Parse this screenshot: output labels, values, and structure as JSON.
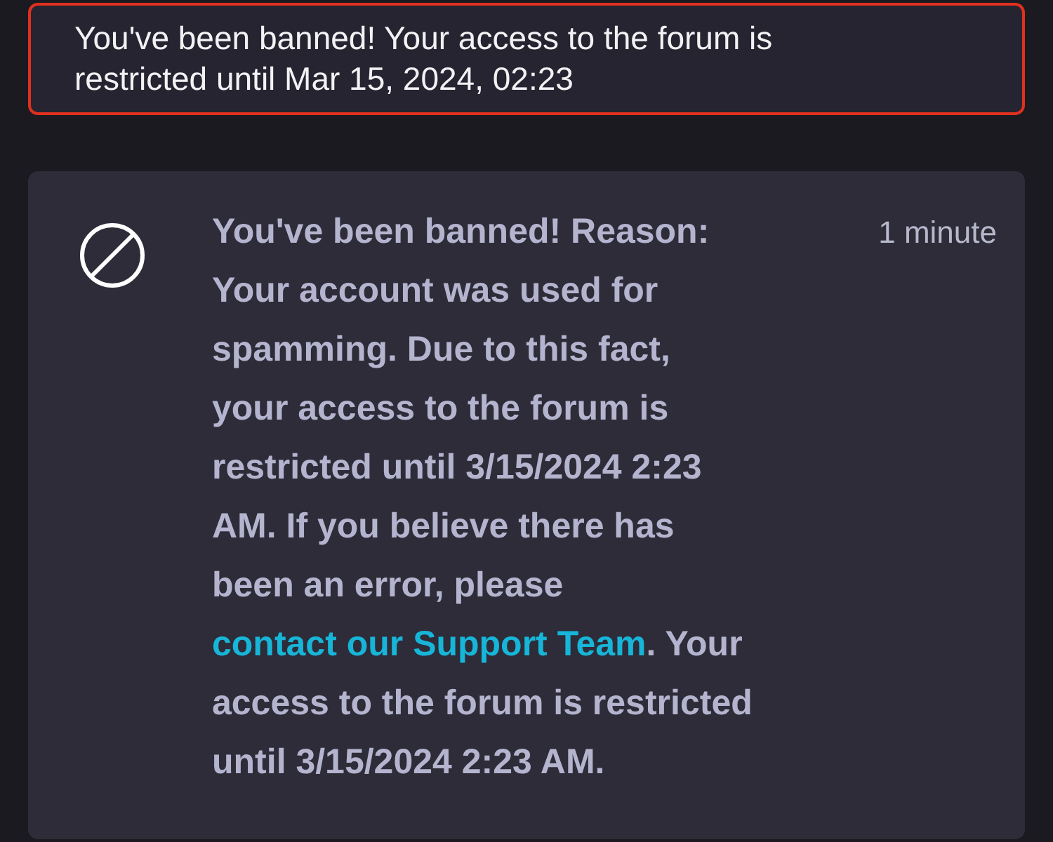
{
  "alert": {
    "text": "You've been banned! Your access to the forum is restricted until Mar 15, 2024, 02:23"
  },
  "notification": {
    "message_before": "You've been banned! Reason: Your account was used for spamming. Due to this fact, your access to the forum is restricted until 3/15/2024 2:23 AM. If you believe there has been an error, please",
    "link": "contact our Support Team",
    "message_after": ". Your access to the forum is restricted until 3/15/2024 2:23 AM.",
    "time": "1 minute"
  }
}
